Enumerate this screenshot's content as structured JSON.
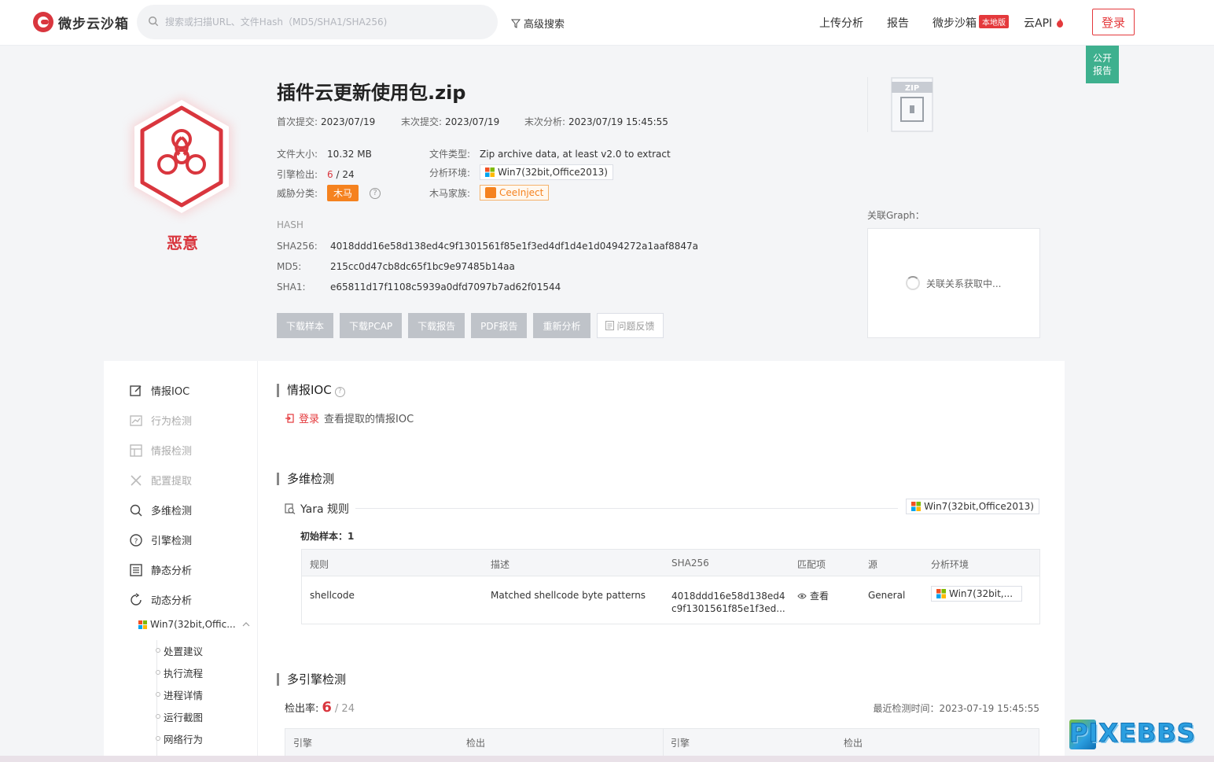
{
  "nav": {
    "logo_text": "微步云沙箱",
    "search_placeholder": "搜索或扫描URL、文件Hash（MD5/SHA1/SHA256)",
    "advanced_search": "高级搜索",
    "upload": "上传分析",
    "report": "报告",
    "sandbox": "微步沙箱",
    "sandbox_badge": "本地版",
    "api": "云API",
    "login": "登录",
    "public_report": [
      "公开",
      "报告"
    ]
  },
  "file": {
    "verdict": "恶意",
    "title": "插件云更新使用包.zip",
    "first_submit_label": "首次提交:",
    "first_submit": "2023/07/19",
    "last_submit_label": "末次提交:",
    "last_submit": "2023/07/19",
    "last_analysis_label": "末次分析:",
    "last_analysis": "2023/07/19 15:45:55",
    "size_label": "文件大小:",
    "size": "10.32 MB",
    "type_label": "文件类型:",
    "type": "Zip archive data, at least v2.0 to extract",
    "engine_label": "引擎检出:",
    "engine_hits": "6",
    "engine_total": " / 24",
    "env_label": "分析环境:",
    "env": "Win7(32bit,Office2013)",
    "threat_label": "威胁分类:",
    "threat": "木马",
    "family_label": "木马家族:",
    "family": "CeeInject",
    "zip_label": "ZIP"
  },
  "hash": {
    "heading": "HASH",
    "sha256_label": "SHA256:",
    "sha256": "4018ddd16e58d138ed4c9f1301561f85e1f3ed4df1d4e1d0494272a1aaf8847a",
    "md5_label": "MD5:",
    "md5": "215cc0d47cb8dc65f1bc9e97485b14aa",
    "sha1_label": "SHA1:",
    "sha1": "e65811d17f1108c5939a0dfd7097b7ad62f01544"
  },
  "actions": [
    "下载样本",
    "下载PCAP",
    "下载报告",
    "PDF报告",
    "重新分析"
  ],
  "feedback": "问题反馈",
  "graph": {
    "label": "关联Graph：",
    "loading": "关联关系获取中..."
  },
  "sidebar": {
    "items": [
      "情报IOC",
      "行为检测",
      "情报检测",
      "配置提取",
      "多维检测",
      "引擎检测",
      "静态分析",
      "动态分析"
    ],
    "env": "Win7(32bit,Offic...",
    "subs": [
      "处置建议",
      "执行流程",
      "进程详情",
      "运行截图",
      "网络行为"
    ]
  },
  "ioc": {
    "title": "情报IOC",
    "login": "登录",
    "hint": "查看提取的情报IOC"
  },
  "multi": {
    "title": "多维检测",
    "yara": "Yara 规则",
    "env": "Win7(32bit,Office2013)",
    "initial": "初始样本：1",
    "headers": [
      "规则",
      "描述",
      "SHA256",
      "匹配项",
      "源",
      "分析环境"
    ],
    "row": {
      "rule": "shellcode",
      "desc": "Matched shellcode byte patterns",
      "sha_line1": "4018ddd16e58d138ed4",
      "sha_line2": "c9f1301561f85e1f3ed...",
      "match": "查看",
      "source": "General",
      "env": "Win7(32bit,..."
    }
  },
  "engines": {
    "title": "多引擎检测",
    "rate_label": "检出率:",
    "hits": "6",
    "total": "/ 24",
    "last_time": "最近检测时间：2023-07-19 15:45:55",
    "headers": [
      "引擎",
      "检出",
      "引擎",
      "检出"
    ]
  },
  "watermark": "PIXEBBS",
  "colors": {
    "malicious": "#d9363e",
    "trojan": "#f5821f",
    "public": "#3eb08e"
  }
}
